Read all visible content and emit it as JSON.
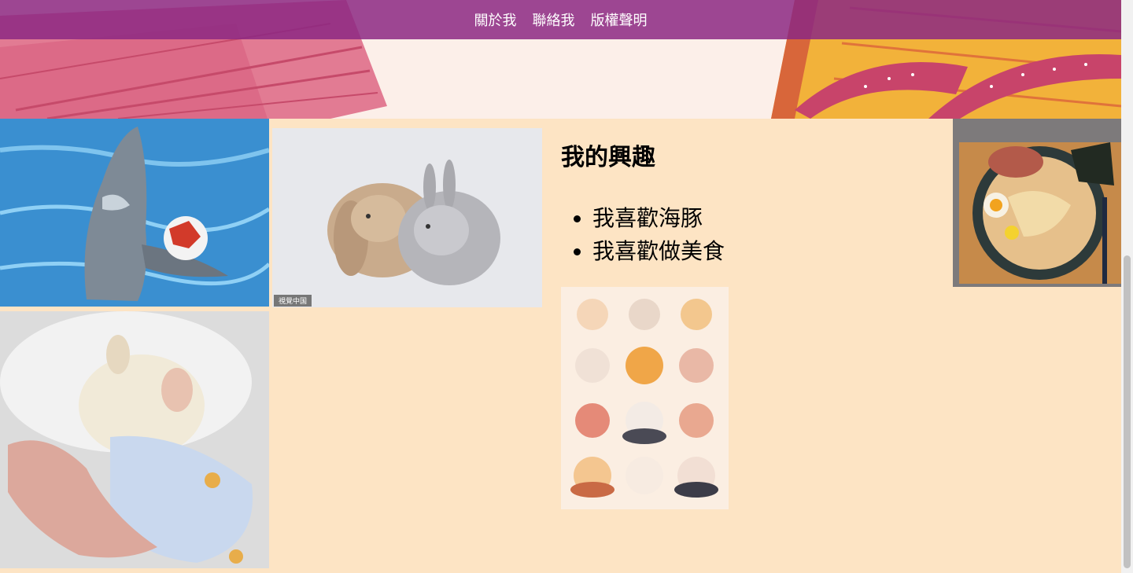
{
  "nav": {
    "links": [
      "關於我",
      "聯絡我",
      "版權聲明"
    ],
    "background": "#8c2882"
  },
  "interests": {
    "heading": "我的興趣",
    "items": [
      "我喜歡海豚",
      "我喜歡做美食"
    ]
  },
  "images": {
    "rabbit_watermark": "視覺中国"
  },
  "colors": {
    "page_background": "#fde4c4",
    "banner_background": "#fcefe9",
    "banner_pink": "#e06a8a",
    "banner_yellow": "#f2b23a"
  }
}
